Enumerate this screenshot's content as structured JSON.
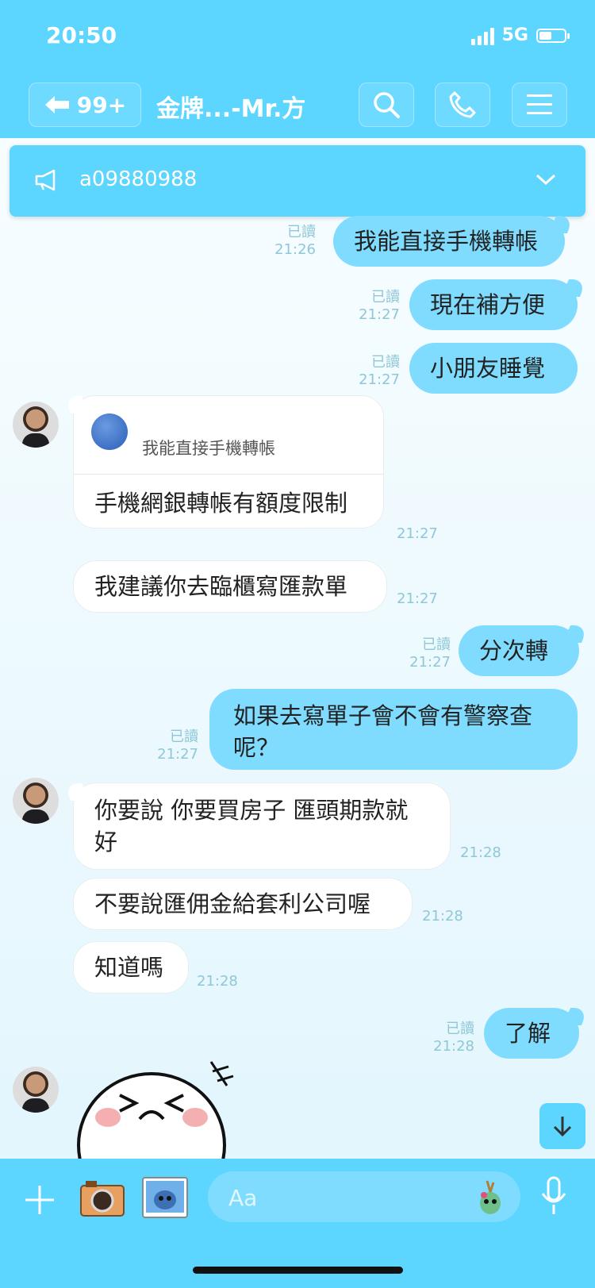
{
  "status": {
    "time": "20:50",
    "network": "5G"
  },
  "header": {
    "back_badge": "99+",
    "title": "金牌...-Mr.方"
  },
  "announcement": {
    "text": "a09880988"
  },
  "composer": {
    "placeholder": "Aa"
  },
  "messages": [
    {
      "dir": "out",
      "text": "我能直接手機轉帳",
      "read": "已讀",
      "time": "21:26"
    },
    {
      "dir": "out",
      "text": "現在補方便",
      "read": "已讀",
      "time": "21:27"
    },
    {
      "dir": "out",
      "text": "小朋友睡覺",
      "read": "已讀",
      "time": "21:27"
    },
    {
      "dir": "in",
      "quote": "我能直接手機轉帳",
      "text": "手機網銀轉帳有額度限制",
      "time": "21:27"
    },
    {
      "dir": "in",
      "text": "我建議你去臨櫃寫匯款單",
      "time": "21:27"
    },
    {
      "dir": "out",
      "text": "分次轉",
      "read": "已讀",
      "time": "21:27"
    },
    {
      "dir": "out",
      "text": "如果去寫單子會不會有警察查呢？",
      "read": "已讀",
      "time": "21:27"
    },
    {
      "dir": "in",
      "text": "你要說 你要買房子 匯頭期款就好",
      "time": "21:28"
    },
    {
      "dir": "in",
      "text": "不要說匯佣金給套利公司喔",
      "time": "21:28"
    },
    {
      "dir": "in",
      "text": "知道嗎",
      "time": "21:28"
    },
    {
      "dir": "out",
      "text": "了解",
      "read": "已讀",
      "time": "21:28"
    }
  ],
  "colors": {
    "header": "#5cd5ff",
    "bubble_out": "#7fdcff",
    "bubble_in": "#ffffff"
  }
}
